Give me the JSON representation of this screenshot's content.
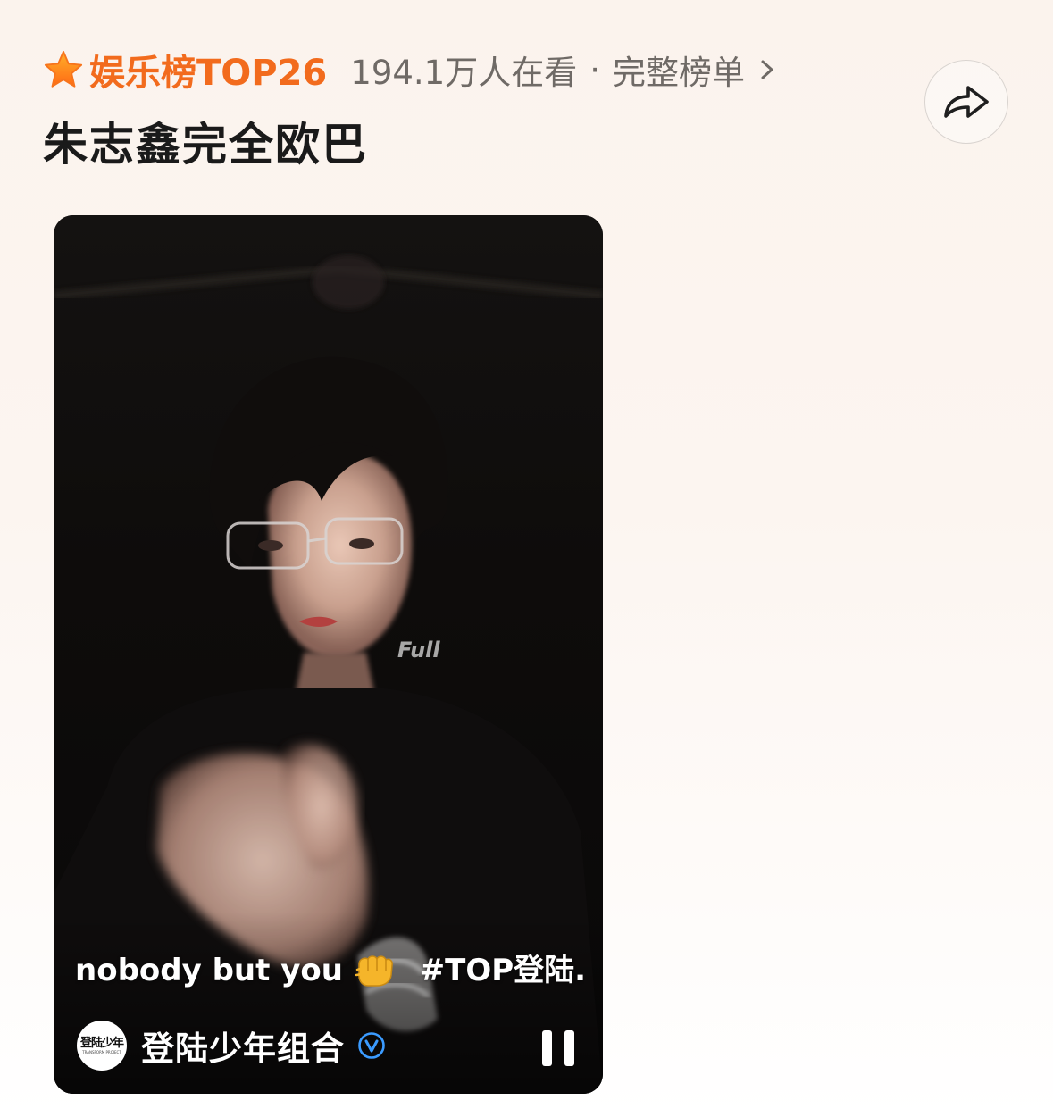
{
  "hotlist": {
    "rank_label": "娱乐榜TOP26",
    "viewers": "194.1万人在看",
    "separator": "·",
    "full_list_link": "完整榜单",
    "star_icon": "star-icon",
    "chevron_icon": "chevron-right-icon",
    "accent_color": "#f26b1d"
  },
  "topic": {
    "title": "朱志鑫完全欧巴"
  },
  "share": {
    "icon": "share-arrow-icon"
  },
  "video": {
    "caption_text": "nobody but you",
    "caption_emoji": "fist-icon",
    "caption_hashtag": "#TOP登陆...",
    "author": {
      "name": "登陆少年组合",
      "avatar_text": "登陆少年",
      "avatar_subtext": "TRANSFORM PROJECT",
      "verified_icon": "verified-badge-icon",
      "verified_color": "#3b9bff"
    },
    "playback_icon": "pause-icon"
  }
}
